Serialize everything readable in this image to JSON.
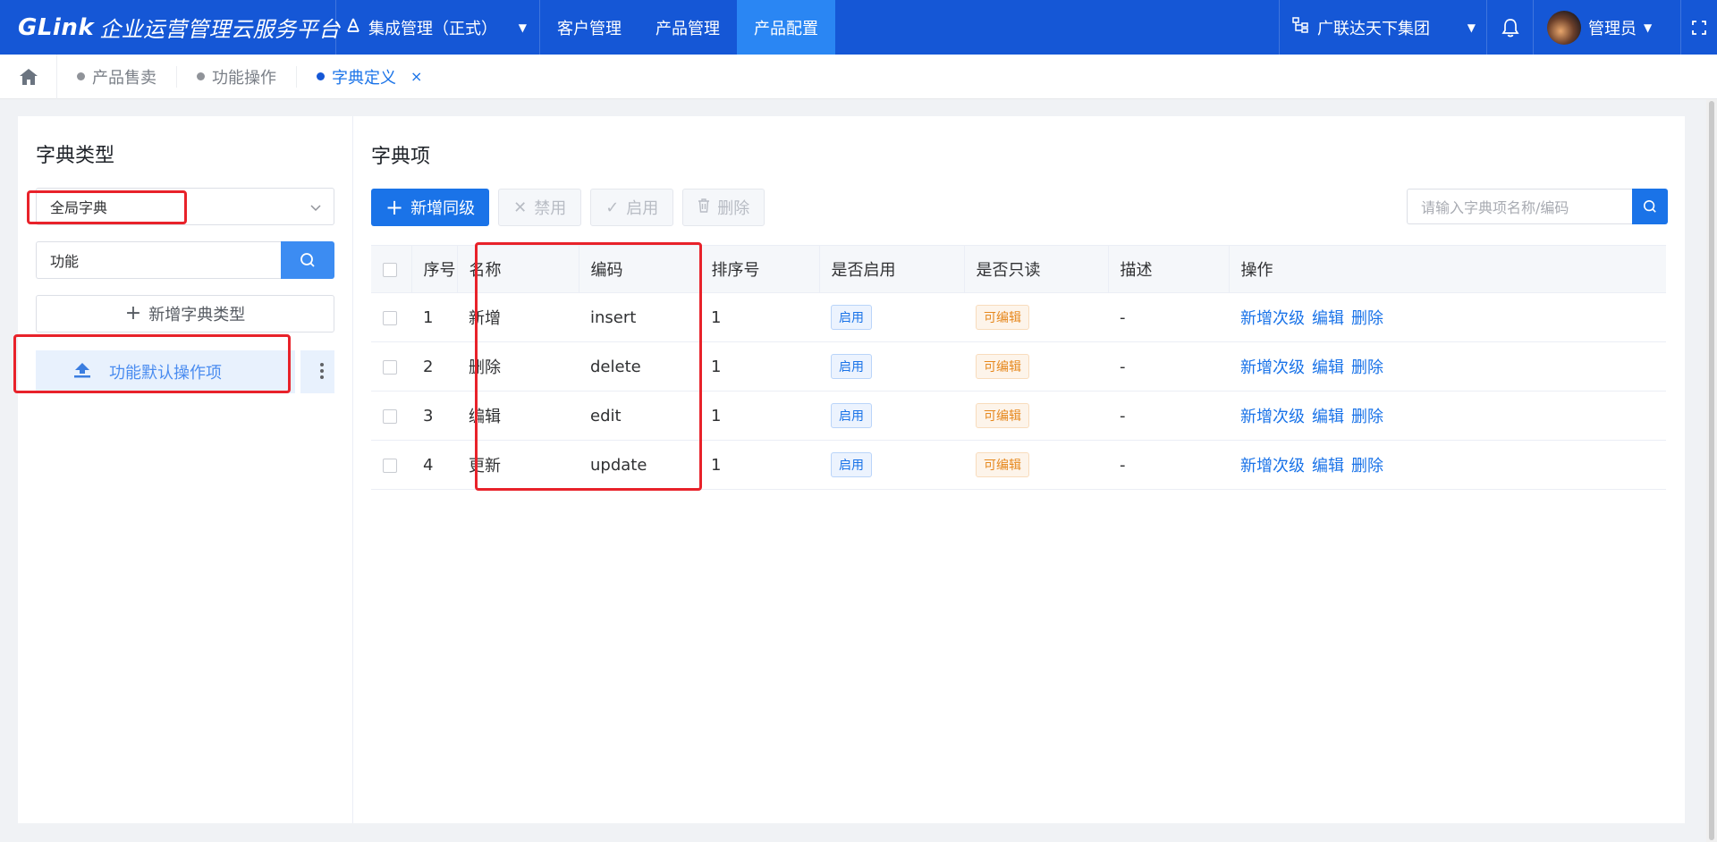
{
  "app": {
    "logo_brand": "GLink",
    "logo_text": "企业运营管理云服务平台"
  },
  "topbar": {
    "system_select": "集成管理（正式）",
    "nav": [
      {
        "label": "客户管理"
      },
      {
        "label": "产品管理"
      },
      {
        "label": "产品配置",
        "active": true
      }
    ],
    "org": "广联达天下集团",
    "user": "管理员"
  },
  "tabs": [
    {
      "label": "产品售卖"
    },
    {
      "label": "功能操作"
    },
    {
      "label": "字典定义",
      "active": true
    }
  ],
  "left_panel": {
    "title": "字典类型",
    "scope_select": "全局字典",
    "search_value": "功能",
    "add_button": "新增字典类型",
    "tree_items": [
      {
        "label": "功能默认操作项"
      }
    ]
  },
  "right_panel": {
    "title": "字典项",
    "toolbar": {
      "add_sibling": "新增同级",
      "disable": "禁用",
      "enable": "启用",
      "delete": "删除"
    },
    "search_placeholder": "请输入字典项名称/编码",
    "columns": [
      "序号",
      "名称",
      "编码",
      "排序号",
      "是否启用",
      "是否只读",
      "描述",
      "操作"
    ],
    "rows": [
      {
        "index": "1",
        "name": "新增",
        "code": "insert",
        "sort": "1",
        "enabled": "启用",
        "readonly": "可编辑",
        "desc": "-"
      },
      {
        "index": "2",
        "name": "删除",
        "code": "delete",
        "sort": "1",
        "enabled": "启用",
        "readonly": "可编辑",
        "desc": "-"
      },
      {
        "index": "3",
        "name": "编辑",
        "code": "edit",
        "sort": "1",
        "enabled": "启用",
        "readonly": "可编辑",
        "desc": "-"
      },
      {
        "index": "4",
        "name": "更新",
        "code": "update",
        "sort": "1",
        "enabled": "启用",
        "readonly": "可编辑",
        "desc": "-"
      }
    ],
    "row_actions": {
      "add_child": "新增次级",
      "edit": "编辑",
      "delete": "删除"
    }
  },
  "colors": {
    "topbar": "#1557d6",
    "nav_active": "#2a86f3",
    "primary": "#1a73e8",
    "annotation": "#e8222a"
  }
}
